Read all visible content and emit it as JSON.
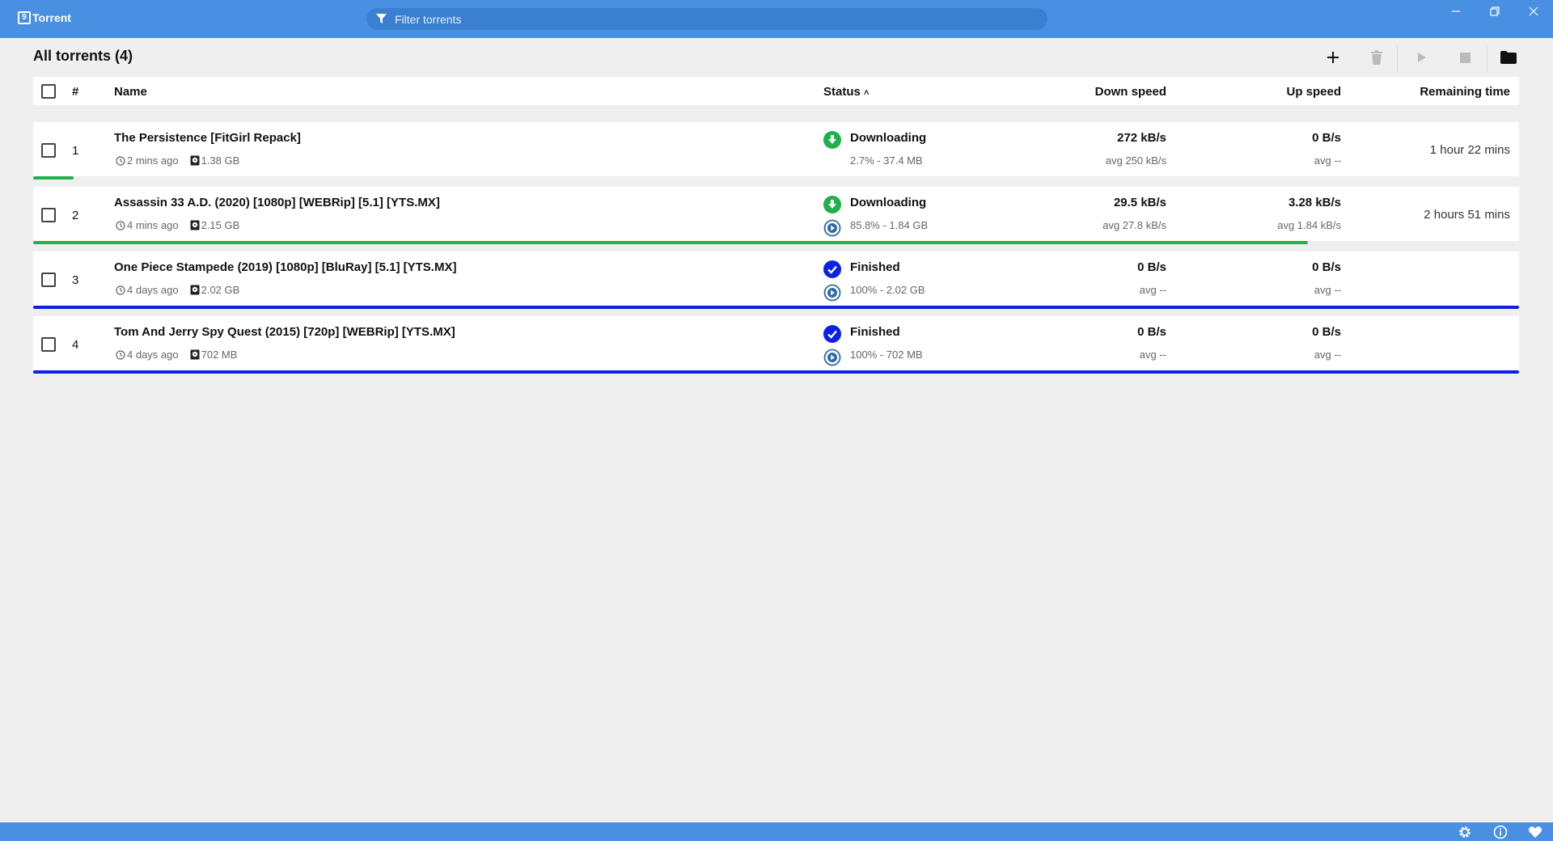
{
  "app": {
    "title": "Torrent",
    "logo_glyph": "9"
  },
  "filter": {
    "placeholder": "Filter torrents"
  },
  "toolbar": {
    "title": "All torrents (4)"
  },
  "columns": {
    "index": "#",
    "name": "Name",
    "status": "Status",
    "status_sort": "˄",
    "down": "Down speed",
    "up": "Up speed",
    "remaining": "Remaining time"
  },
  "colors": {
    "accent": "#4a90e2",
    "downloading": "#21b04b",
    "finished": "#0c21e6"
  },
  "torrents": [
    {
      "index": "1",
      "name": "The Persistence [FitGirl Repack]",
      "added": "2 mins ago",
      "size": "1.38 GB",
      "status": "Downloading",
      "status_detail": "2.7% - 37.4 MB",
      "down": "272 kB/s",
      "down_avg": "avg 250 kB/s",
      "up": "0 B/s",
      "up_avg": "avg --",
      "remaining": "1 hour 22 mins",
      "progress": 0.027,
      "state": "downloading",
      "show_play": false
    },
    {
      "index": "2",
      "name": "Assassin 33 A.D. (2020) [1080p] [WEBRip] [5.1] [YTS.MX]",
      "added": "4 mins ago",
      "size": "2.15 GB",
      "status": "Downloading",
      "status_detail": "85.8% - 1.84 GB",
      "down": "29.5 kB/s",
      "down_avg": "avg 27.8 kB/s",
      "up": "3.28 kB/s",
      "up_avg": "avg 1.84 kB/s",
      "remaining": "2 hours 51 mins",
      "progress": 0.858,
      "state": "downloading",
      "show_play": true
    },
    {
      "index": "3",
      "name": "One Piece Stampede (2019) [1080p] [BluRay] [5.1] [YTS.MX]",
      "added": "4 days ago",
      "size": "2.02 GB",
      "status": "Finished",
      "status_detail": "100% - 2.02 GB",
      "down": "0 B/s",
      "down_avg": "avg --",
      "up": "0 B/s",
      "up_avg": "avg --",
      "remaining": "",
      "progress": 1.0,
      "state": "finished",
      "show_play": true
    },
    {
      "index": "4",
      "name": "Tom And Jerry Spy Quest (2015) [720p] [WEBRip] [YTS.MX]",
      "added": "4 days ago",
      "size": "702 MB",
      "status": "Finished",
      "status_detail": "100% - 702 MB",
      "down": "0 B/s",
      "down_avg": "avg --",
      "up": "0 B/s",
      "up_avg": "avg --",
      "remaining": "",
      "progress": 1.0,
      "state": "finished",
      "show_play": true
    }
  ],
  "icons": {
    "toolbar": [
      "plus-icon",
      "trash-icon",
      "play-icon",
      "stop-icon",
      "folder-icon"
    ],
    "statusbar": [
      "gear-icon",
      "info-icon",
      "heart-icon"
    ]
  }
}
